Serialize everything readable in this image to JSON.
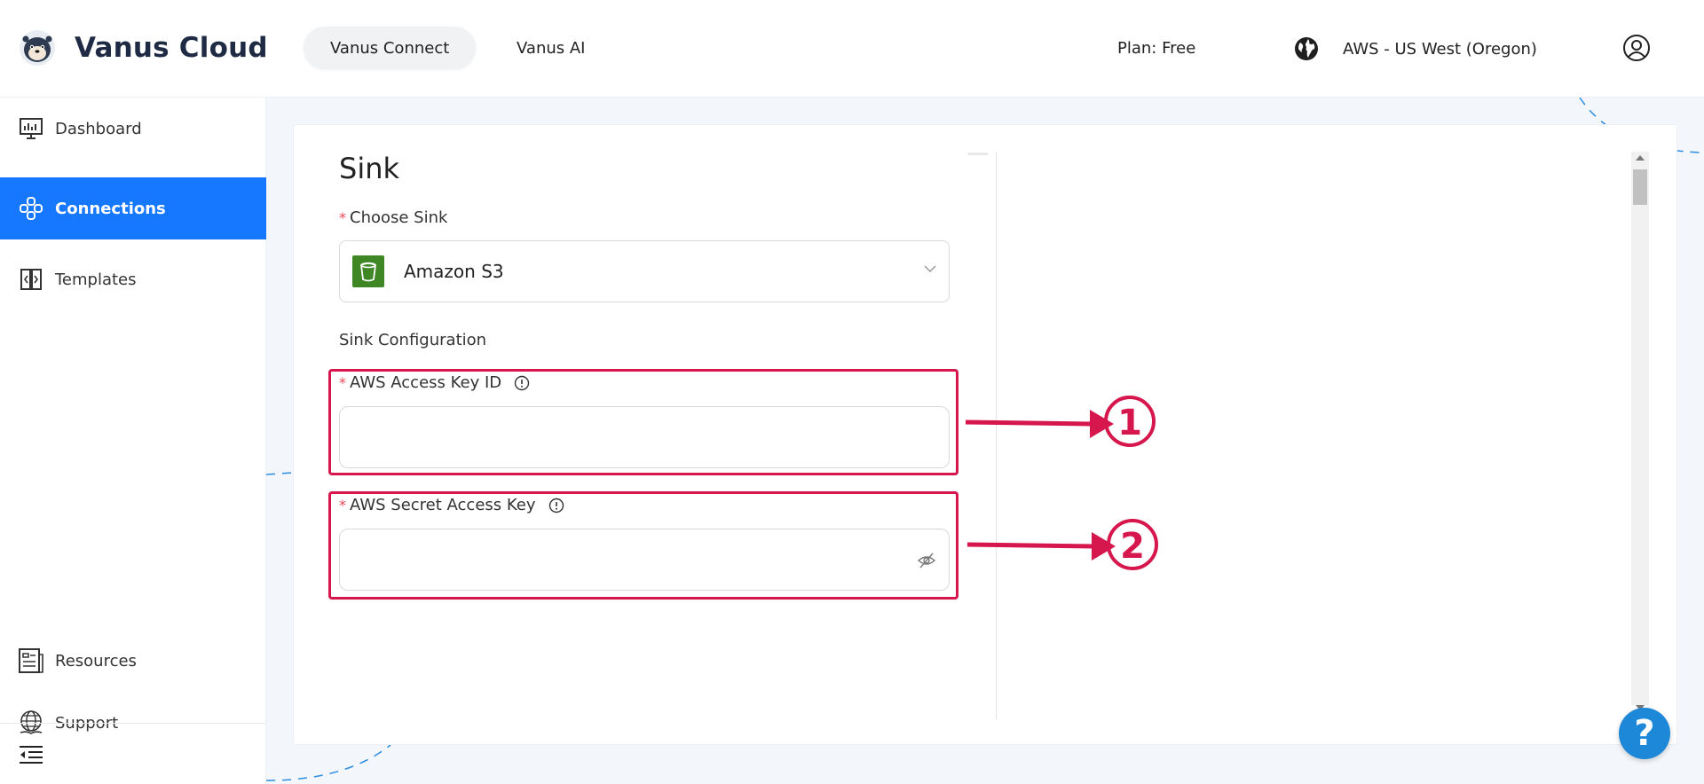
{
  "brand": {
    "name": "Vanus Cloud"
  },
  "header": {
    "tabs": [
      {
        "label": "Vanus Connect",
        "active": true
      },
      {
        "label": "Vanus AI",
        "active": false
      }
    ],
    "plan": "Plan: Free",
    "region": "AWS - US West (Oregon)"
  },
  "sidebar": {
    "items": [
      {
        "label": "Dashboard",
        "icon": "dashboard-icon"
      },
      {
        "label": "Connections",
        "icon": "connections-icon",
        "active": true
      },
      {
        "label": "Templates",
        "icon": "templates-icon"
      },
      {
        "label": "Resources",
        "icon": "resources-icon"
      },
      {
        "label": "Support",
        "icon": "support-icon"
      }
    ]
  },
  "form": {
    "title": "Sink",
    "choose_sink": {
      "label": "Choose Sink",
      "value": "Amazon S3"
    },
    "section": "Sink Configuration",
    "access_key": {
      "label": "AWS Access Key ID",
      "value": ""
    },
    "secret_key": {
      "label": "AWS Secret Access Key",
      "value": ""
    }
  },
  "annotations": {
    "marker_1": "1",
    "marker_2": "2"
  },
  "help": {
    "label": "?"
  },
  "colors": {
    "accent": "#1677ff",
    "highlight": "#d6174d",
    "s3": "#3f8624",
    "help": "#1e88d8"
  }
}
